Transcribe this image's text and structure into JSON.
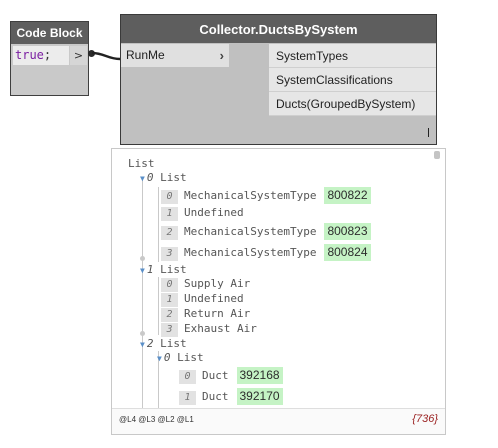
{
  "code_block": {
    "title": "Code Block",
    "code_keyword": "true",
    "code_punct": ";",
    "output_port": ">"
  },
  "collector": {
    "title": "Collector.DuctsBySystem",
    "input_port": "RunMe",
    "input_arrow": "›",
    "outputs": [
      "SystemTypes",
      "SystemClassifications",
      "Ducts(GroupedBySystem)"
    ]
  },
  "preview": {
    "root_label": "List",
    "groups": [
      {
        "index": "0",
        "label": "List",
        "items": [
          {
            "index": "0",
            "text": "MechanicalSystemType",
            "value": "800822"
          },
          {
            "index": "1",
            "text": "Undefined",
            "value": ""
          },
          {
            "index": "2",
            "text": "MechanicalSystemType",
            "value": "800823"
          },
          {
            "index": "3",
            "text": "MechanicalSystemType",
            "value": "800824"
          }
        ]
      },
      {
        "index": "1",
        "label": "List",
        "items": [
          {
            "index": "0",
            "text": "Supply Air"
          },
          {
            "index": "1",
            "text": "Undefined"
          },
          {
            "index": "2",
            "text": "Return Air"
          },
          {
            "index": "3",
            "text": "Exhaust Air"
          }
        ]
      },
      {
        "index": "2",
        "label": "List",
        "sub_index": "0",
        "sub_label": "List",
        "items": [
          {
            "index": "0",
            "text": "Duct",
            "value": "392168"
          },
          {
            "index": "1",
            "text": "Duct",
            "value": "392170"
          }
        ]
      }
    ],
    "levels": [
      "@L4",
      "@L3",
      "@L2",
      "@L1"
    ],
    "count": "{736}"
  },
  "colors": {
    "node_header": "#5e5e5e",
    "value_highlight": "#c5f3c5",
    "count_color": "#9b2222",
    "expander": "#5a8fc8"
  }
}
